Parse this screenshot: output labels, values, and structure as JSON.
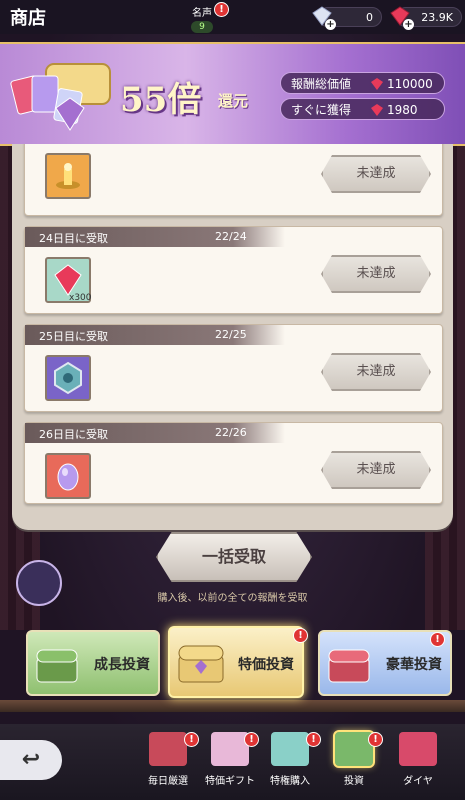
{
  "header": {
    "title": "商店",
    "fame_label": "名声",
    "fame_value": "9",
    "currency1_value": "0",
    "currency2_value": "23.9K",
    "alert_mark": "!"
  },
  "banner": {
    "multiplier": "55倍",
    "multiplier_suffix": "還元",
    "total_value_label": "報酬総価値",
    "total_value": "110000",
    "instant_label": "すぐに獲得",
    "instant_value": "1980"
  },
  "rewards": [
    {
      "day": "",
      "progress": "",
      "status": "未達成",
      "icon": "lamp-icon",
      "qty": ""
    },
    {
      "day": "24日目に受取",
      "progress": "22/24",
      "status": "未達成",
      "icon": "ruby-icon",
      "qty": "x300"
    },
    {
      "day": "25日目に受取",
      "progress": "22/25",
      "status": "未達成",
      "icon": "emblem-icon",
      "qty": ""
    },
    {
      "day": "26日目に受取",
      "progress": "22/26",
      "status": "未達成",
      "icon": "egg-icon",
      "qty": ""
    }
  ],
  "bulk": {
    "label": "一括受取",
    "hint": "購入後、以前の全ての報酬を受取"
  },
  "tiers": [
    {
      "label": "成長投資"
    },
    {
      "label": "特価投資"
    },
    {
      "label": "豪華投資"
    }
  ],
  "nav": {
    "back_glyph": "↩",
    "items": [
      {
        "label": "毎日厳選",
        "icon": "daily-pick-icon"
      },
      {
        "label": "特価ギフト",
        "icon": "gift-bag-icon"
      },
      {
        "label": "特権購入",
        "icon": "privilege-icon"
      },
      {
        "label": "投資",
        "icon": "investment-icon"
      },
      {
        "label": "ダイヤ",
        "icon": "diamond-icon"
      }
    ]
  },
  "colors": {
    "accent_gold": "#e6c06a",
    "alert_red": "#e03434",
    "banner_purple": "#a46fd0"
  }
}
